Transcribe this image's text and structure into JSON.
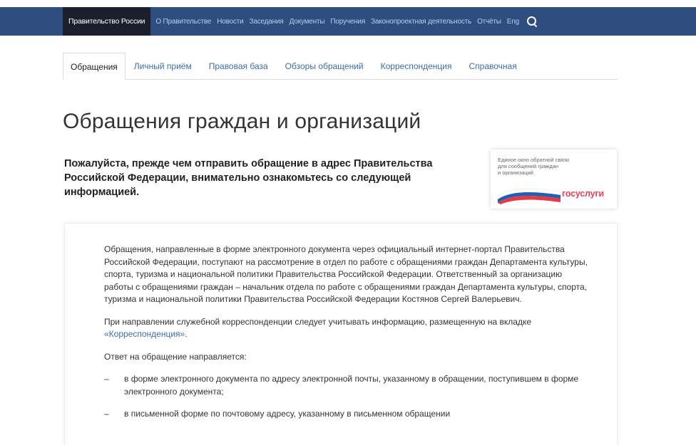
{
  "header": {
    "brand": "Правительство России",
    "nav": [
      "О Правительстве",
      "Новости",
      "Заседания",
      "Документы",
      "Поручения",
      "Законопроектная деятельность",
      "Отчёты",
      "Eng"
    ],
    "search_icon": "search-icon"
  },
  "tabs": [
    "Обращения",
    "Личный приём",
    "Правовая база",
    "Обзоры обращений",
    "Корреспонденция",
    "Справочная"
  ],
  "active_tab": "Обращения",
  "page": {
    "title": "Обращения граждан и организаций",
    "intro": "Пожалуйста, прежде чем отправить обращение в адрес Правительства Российской Федерации, внимательно ознакомьтесь со следующей информацией."
  },
  "gosuslugi": {
    "text_line1": "Единое окно обратной связи",
    "text_line2": "для сообщений граждан",
    "text_line3": "и организаций",
    "logo_word": "госуслуги"
  },
  "content": {
    "para1": "Обращения, направленные в форме электронного документа через официальный интернет-портал Правительства Российской Федерации, поступают на рассмотрение в отдел по работе с обращениями граждан Департамента культуры, спорта, туризма и национальной политики Правительства Российской Федерации. Ответственный за организацию работы с обращениями граждан – начальник отдела по работе с обращениями граждан Департамента культуры, спорта, туризма и национальной политики Правительства Российской Федерации Костянов Сергей Валерьевич.",
    "para2_text": "При направлении служебной корреспонденции следует учитывать информацию, размещенную на вкладке ",
    "para2_link": "«Корреспонденция»",
    "para2_end": ".",
    "para3": "Ответ на обращение направляется:",
    "list": [
      "в форме электронного документа по адресу электронной почты, указанному в обращении, поступившем в форме электронного документа;",
      "в письменной форме по почтовому адресу, указанному в письменном обращении"
    ],
    "dash": "–"
  },
  "colors": {
    "topbar": "#2f4e80",
    "brand_bg": "#1a1f2b",
    "link": "#3c6da8",
    "gosuslugi_red": "#ee3f58"
  }
}
